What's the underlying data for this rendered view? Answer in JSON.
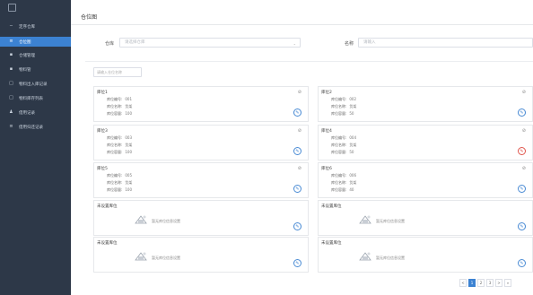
{
  "sidebar": {
    "items": [
      {
        "icon": "minus-icon",
        "glyph": "−",
        "label": "定序仓库",
        "active": false
      },
      {
        "icon": "list-icon",
        "glyph": "≡",
        "label": "仓位图",
        "active": true
      },
      {
        "icon": "box-icon",
        "glyph": "▪",
        "label": "仓储管理",
        "active": false
      },
      {
        "icon": "box-icon",
        "glyph": "▪",
        "label": "物料管",
        "active": false
      },
      {
        "icon": "doc-icon",
        "glyph": "□",
        "label": "物料出入库记录",
        "active": false
      },
      {
        "icon": "doc-icon",
        "glyph": "□",
        "label": "物料库存列表",
        "active": false
      },
      {
        "icon": "user-icon",
        "glyph": "♟",
        "label": "借用记录",
        "active": false
      },
      {
        "icon": "list-icon",
        "glyph": "≡",
        "label": "借用归还记录",
        "active": false
      }
    ]
  },
  "header": {
    "title": "仓位图"
  },
  "filters": {
    "warehouse": {
      "label": "仓库",
      "placeholder": "请选择仓库"
    },
    "name": {
      "label": "名称",
      "placeholder": "请输入"
    }
  },
  "search": {
    "placeholder": "请输入仓位名称"
  },
  "cards": [
    {
      "title": "库位1",
      "rows": [
        [
          "库位编号:",
          "001"
        ],
        [
          "库位名称:",
          "货架"
        ],
        [
          "库位容量:",
          "100"
        ]
      ],
      "edit_color": "#4a8bd4"
    },
    {
      "title": "库位2",
      "rows": [
        [
          "库位编号:",
          "002"
        ],
        [
          "库位名称:",
          "货架"
        ],
        [
          "库位容量:",
          "50"
        ]
      ],
      "edit_color": "#4a8bd4"
    },
    {
      "title": "库位3",
      "rows": [
        [
          "库位编号:",
          "003"
        ],
        [
          "库位名称:",
          "货架"
        ],
        [
          "库位容量:",
          "100"
        ]
      ],
      "edit_color": "#4a8bd4"
    },
    {
      "title": "库位4",
      "rows": [
        [
          "库位编号:",
          "004"
        ],
        [
          "库位名称:",
          "货架"
        ],
        [
          "库位容量:",
          "50"
        ]
      ],
      "edit_color": "#e0564d"
    },
    {
      "title": "库位5",
      "rows": [
        [
          "库位编号:",
          "005"
        ],
        [
          "库位名称:",
          "货架"
        ],
        [
          "库位容量:",
          "100"
        ]
      ],
      "edit_color": "#4a8bd4"
    },
    {
      "title": "库位6",
      "rows": [
        [
          "库位编号:",
          "006"
        ],
        [
          "库位名称:",
          "货架"
        ],
        [
          "库位容量:",
          "40"
        ]
      ],
      "edit_color": "#4a8bd4"
    },
    {
      "title": "未设置库位",
      "empty_text": "暂无库位信息设置",
      "edit_color": "#4a8bd4"
    },
    {
      "title": "未设置库位",
      "empty_text": "暂无库位信息设置",
      "edit_color": "#4a8bd4"
    },
    {
      "title": "未设置库位",
      "empty_text": "暂无库位信息设置",
      "edit_color": "#4a8bd4"
    },
    {
      "title": "未设置库位",
      "empty_text": "暂无库位信息设置",
      "edit_color": "#4a8bd4"
    }
  ],
  "pagination": {
    "prev": "<",
    "pages": [
      "1",
      "2",
      "3"
    ],
    "active": "1",
    "next": ">",
    "jump": "»"
  },
  "colors": {
    "sidebar_bg": "#2d3848",
    "accent": "#3c82d2"
  }
}
